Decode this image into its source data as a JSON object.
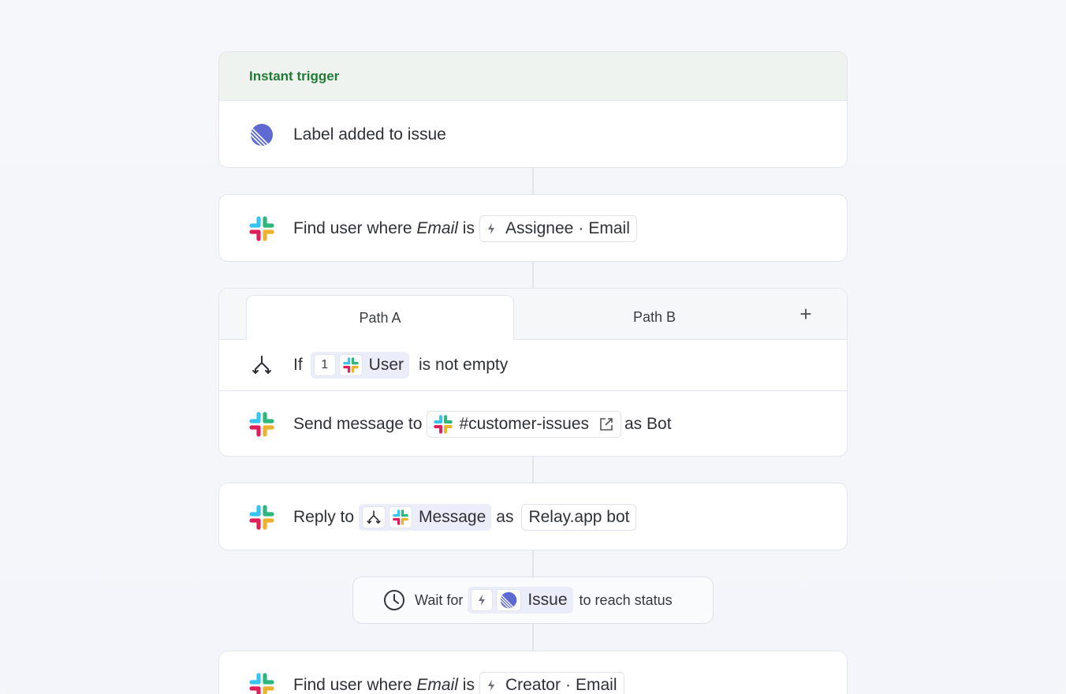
{
  "trigger": {
    "header": "Instant trigger",
    "text": "Label added to issue",
    "icon": "linear-icon"
  },
  "find_user_1": {
    "prefix": "Find user where",
    "field": "Email",
    "verb": "is",
    "token_source": "Assignee",
    "token_sep": "·",
    "token_field": "Email"
  },
  "paths": {
    "tabs": [
      "Path A",
      "Path B"
    ],
    "add_label": "+",
    "condition": {
      "prefix": "If",
      "step_number": "1",
      "token": "User",
      "suffix": "is not empty"
    },
    "send": {
      "prefix": "Send message to",
      "channel": "#customer-issues",
      "suffix": "as Bot"
    }
  },
  "reply": {
    "prefix": "Reply to",
    "token": "Message",
    "mid": "as",
    "bot": "Relay.app bot"
  },
  "wait": {
    "prefix": "Wait for",
    "token": "Issue",
    "suffix": "to reach status"
  },
  "find_user_2": {
    "prefix": "Find user where",
    "field": "Email",
    "verb": "is",
    "token_source": "Creator",
    "token_sep": "·",
    "token_field": "Email"
  },
  "colors": {
    "trigger_green": "#217a35",
    "linear_purple": "#5e6ad2",
    "token_purple_bg": "#ecedfb"
  }
}
